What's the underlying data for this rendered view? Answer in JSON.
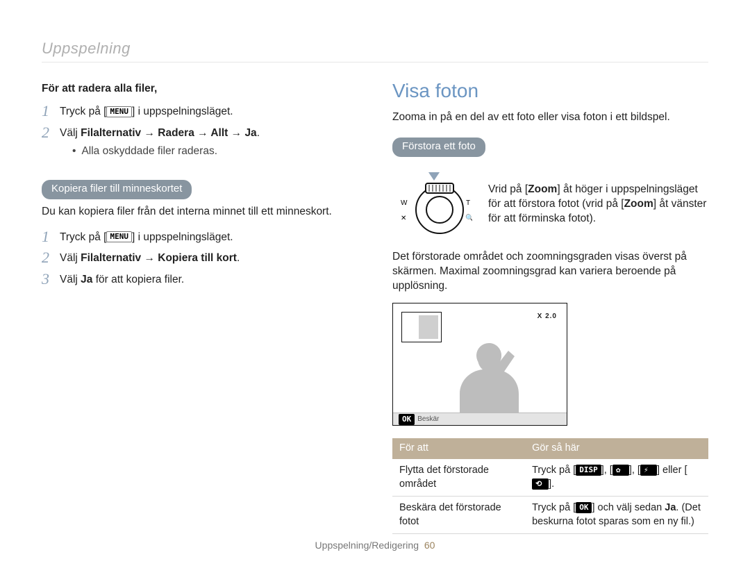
{
  "header": {
    "section": "Uppspelning"
  },
  "left": {
    "delete_all_title": "För att radera alla filer,",
    "steps_delete": [
      {
        "pre": "Tryck på [",
        "key": "MENU",
        "post": "] i uppspelningsläget."
      },
      {
        "full_prefix": "Välj ",
        "bold": "Filalternativ → Radera → Allt → Ja",
        "suffix": "."
      }
    ],
    "delete_bullet": "Alla oskyddade filer raderas.",
    "chip_copy": "Kopiera filer till minneskortet",
    "copy_intro": "Du kan kopiera filer från det interna minnet till ett minneskort.",
    "steps_copy": [
      {
        "pre": "Tryck på [",
        "key": "MENU",
        "post": "] i uppspelningsläget."
      },
      {
        "full_prefix": "Välj ",
        "bold": "Filalternativ → Kopiera till kort",
        "suffix": "."
      },
      {
        "full_prefix": "Välj ",
        "bold": "Ja",
        "suffix": " för att kopiera filer."
      }
    ]
  },
  "right": {
    "title": "Visa foton",
    "intro": "Zooma in på en del av ett foto eller visa foton i ett bildspel.",
    "chip_enlarge": "Förstora ett foto",
    "zoom_pre": "Vrid på [",
    "zoom_kw": "Zoom",
    "zoom_mid1": "] åt höger i uppspelningsläget för att förstora fotot (vrid på [",
    "zoom_mid2": "] åt vänster för att förminska fotot).",
    "dial": {
      "left_top": "W",
      "left_bottom": "✕",
      "right_top": "T",
      "right_bottom": "🔍"
    },
    "zoom_note": "Det förstorade området och zoomningsgraden visas överst på skärmen. Maximal zoomningsgrad kan variera beroende på upplösning.",
    "screen": {
      "zoom": "X 2.0",
      "ok": "OK",
      "crop": "Beskär"
    },
    "table": {
      "h1": "För att",
      "h2": "Gör så här",
      "r1c1": "Flytta det förstorade området",
      "r1_pre": "Tryck på [",
      "r1_k1": "DISP",
      "r1_s1": "], [",
      "r1_k2": "✿",
      "r1_s2": "], [",
      "r1_k3": "⚡",
      "r1_s3": "] eller [",
      "r1_k4": "⟲",
      "r1_s4": "].",
      "r2c1": "Beskära det förstorade fotot",
      "r2_pre": "Tryck på [",
      "r2_key": "OK",
      "r2_mid": "] och välj sedan ",
      "r2_bold": "Ja",
      "r2_suffix": ". (Det beskurna fotot sparas som en ny fil.)"
    }
  },
  "footer": {
    "text": "Uppspelning/Redigering",
    "page": "60"
  }
}
